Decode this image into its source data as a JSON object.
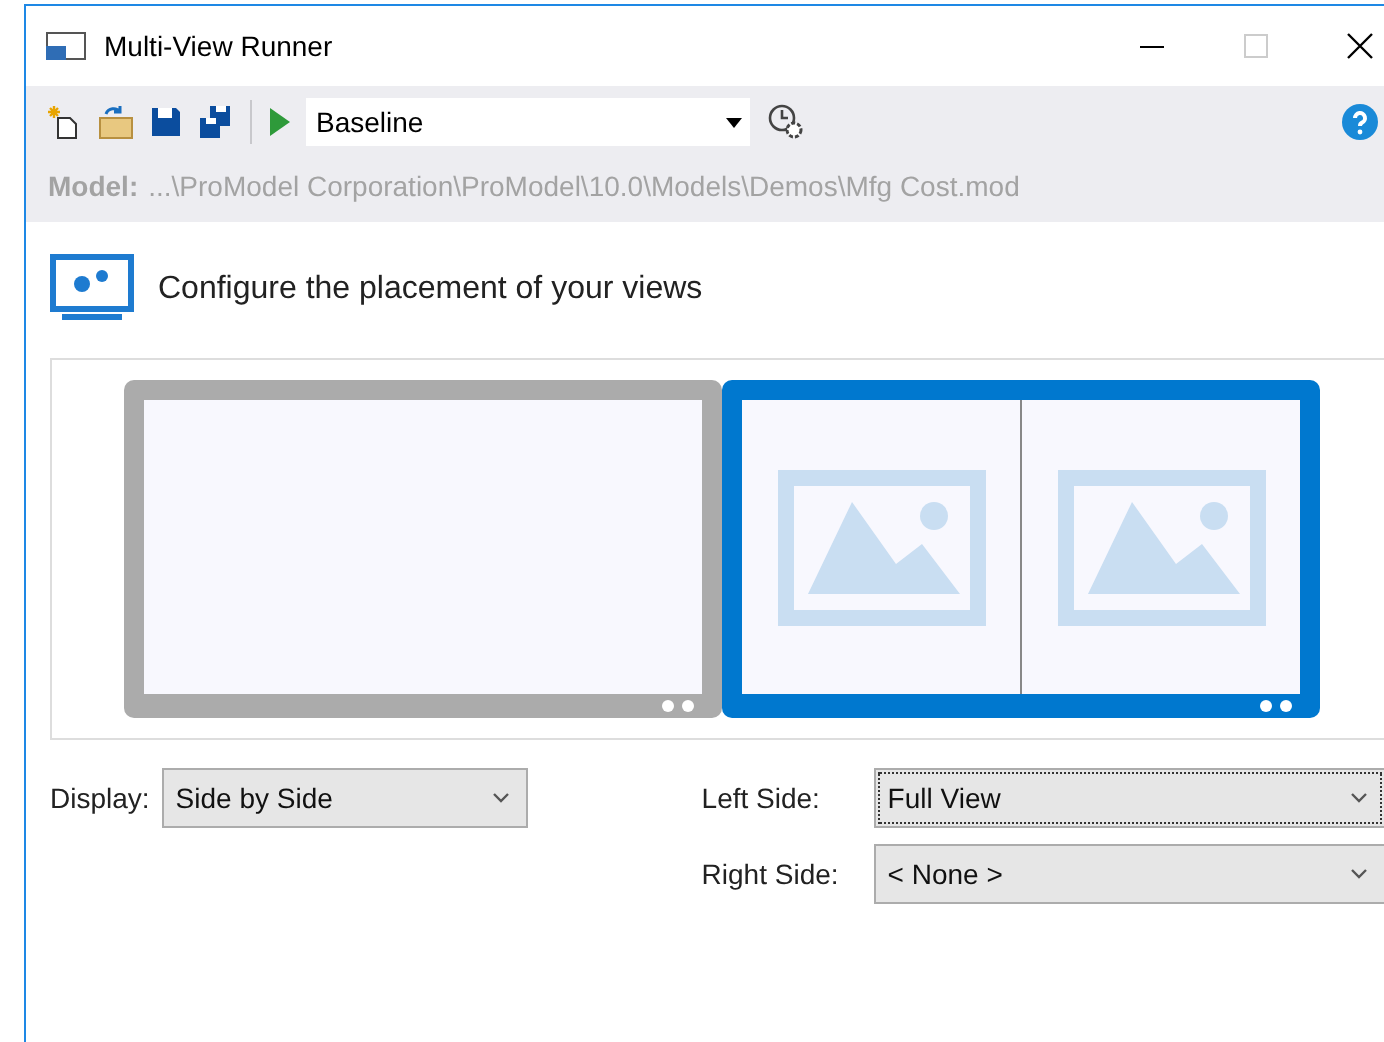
{
  "window": {
    "title": "Multi-View Runner"
  },
  "toolbar": {
    "scenario": "Baseline"
  },
  "model": {
    "label": "Model:",
    "path": "...\\ProModel Corporation\\ProModel\\10.0\\Models\\Demos\\Mfg Cost.mod"
  },
  "heading": "Configure the placement of your views",
  "monitors": [
    {
      "selected": false,
      "panes": [
        {
          "kind": "empty"
        }
      ]
    },
    {
      "selected": true,
      "panes": [
        {
          "kind": "image"
        },
        {
          "kind": "image"
        }
      ]
    }
  ],
  "fields": [
    {
      "label": "Display:",
      "value": "Side by Side",
      "focused": false
    },
    {
      "label": "Left Side:",
      "value": "Full View",
      "focused": true
    },
    {
      "label": "Right Side:",
      "value": "< None >",
      "focused": false
    }
  ]
}
